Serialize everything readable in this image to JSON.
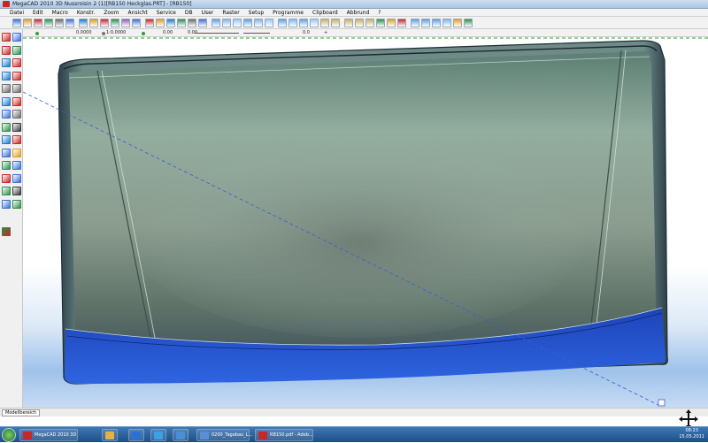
{
  "window": {
    "title": "MegaCAD 2010 3D Nussroisin 2 (1)[RB150 Heckglas.PRT] - [RB150]"
  },
  "menubar": {
    "items": [
      "Datei",
      "Edit",
      "Macro",
      "Konstr.",
      "Zoom",
      "Ansicht",
      "Service",
      "DB",
      "User",
      "Raster",
      "Setup",
      "Programme",
      "Clipboard",
      "Abbrund",
      "?"
    ]
  },
  "toolbar2": {
    "field_a": "0.0000",
    "field_b": "1:0.0000",
    "field_c": "0.00",
    "field_d": "0.00",
    "field_e": "0.0",
    "field_f": "+"
  },
  "palette": {
    "colors": [
      "#ffffff",
      "#1c3a8c",
      "#1e7a35",
      "#1a7a7a",
      "#9a1e1e",
      "#7a1e7a",
      "#7a5a1e",
      "#bdbdbd",
      "#6e6e6e",
      "#2f5fe0",
      "#22c04a",
      "#27c8d8",
      "#e02828",
      "#d03cd0",
      "#e8e030",
      "#000000"
    ]
  },
  "bottom": {
    "model_tab": "Modellbereich"
  },
  "taskbar": {
    "apps": [
      {
        "label": "MegaCAD 2010 3D",
        "icon": "megacad-icon",
        "color": "#c62828"
      },
      {
        "label": "",
        "icon": "explorer-icon",
        "color": "#e3b341"
      },
      {
        "label": "",
        "icon": "media-icon",
        "color": "#2c6fd6"
      },
      {
        "label": "",
        "icon": "ie-icon",
        "color": "#3aa0e8"
      },
      {
        "label": "",
        "icon": "shell-icon",
        "color": "#4a8fd9"
      },
      {
        "label": "0200_Tagebau_L...",
        "icon": "document-icon",
        "color": "#5a8fd6"
      },
      {
        "label": "RB150.pdf - Adob...",
        "icon": "pdf-icon",
        "color": "#c62828"
      }
    ],
    "clock_time": "08:23",
    "clock_date": "15.05.2011"
  }
}
